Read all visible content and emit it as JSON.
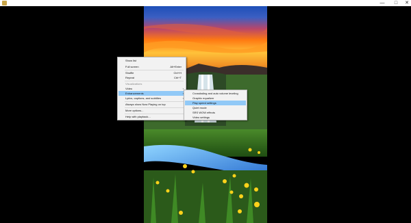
{
  "window": {
    "minimize": "—",
    "maximize": "□",
    "close": "✕",
    "app_icon": "app-icon"
  },
  "context_menu": {
    "items": [
      {
        "label": "Show list",
        "shortcut": "",
        "submenu": false,
        "disabled": false,
        "highlighted": false
      },
      {
        "label": "Full screen",
        "shortcut": "Alt+Enter",
        "submenu": false,
        "disabled": false,
        "highlighted": false
      },
      {
        "label": "Shuffle",
        "shortcut": "Ctrl+H",
        "submenu": false,
        "disabled": false,
        "highlighted": false
      },
      {
        "label": "Repeat",
        "shortcut": "Ctrl+T",
        "submenu": false,
        "disabled": false,
        "highlighted": false
      },
      {
        "label": "Visualizations",
        "shortcut": "",
        "submenu": false,
        "disabled": true,
        "highlighted": false
      },
      {
        "label": "Video",
        "shortcut": "",
        "submenu": true,
        "disabled": false,
        "highlighted": false
      },
      {
        "label": "Enhancements",
        "shortcut": "",
        "submenu": true,
        "disabled": false,
        "highlighted": true
      },
      {
        "label": "Lyrics, captions, and subtitles",
        "shortcut": "",
        "submenu": true,
        "disabled": false,
        "highlighted": false
      },
      {
        "label": "Always show Now Playing on top",
        "shortcut": "",
        "submenu": false,
        "disabled": false,
        "highlighted": false
      },
      {
        "label": "More options...",
        "shortcut": "",
        "submenu": false,
        "disabled": false,
        "highlighted": false
      },
      {
        "label": "Help with playback...",
        "shortcut": "",
        "submenu": false,
        "disabled": false,
        "highlighted": false
      }
    ]
  },
  "enhancements_submenu": {
    "items": [
      {
        "label": "Crossfading and auto volume leveling",
        "highlighted": false
      },
      {
        "label": "Graphic equalizer",
        "highlighted": false
      },
      {
        "label": "Play speed settings",
        "highlighted": true
      },
      {
        "label": "Quiet mode",
        "highlighted": false
      },
      {
        "label": "SRS WOW effects",
        "highlighted": false
      },
      {
        "label": "Video settings",
        "highlighted": false
      }
    ]
  },
  "colors": {
    "menu_bg": "#f2f2f2",
    "highlight": "#91c9f7",
    "sky_top": "#1d4fb8",
    "sunset": "#ff8a1a"
  }
}
